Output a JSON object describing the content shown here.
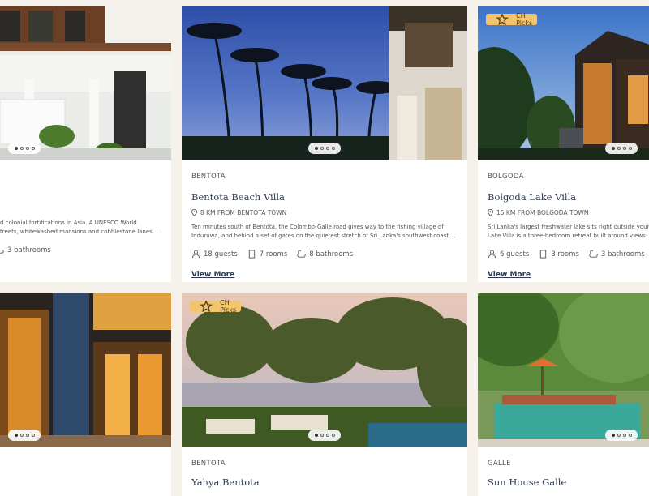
{
  "cards": [
    {
      "region": "",
      "title": "",
      "distance": "",
      "desc_line1": "d colonial fortifications in Asia. A UNESCO World",
      "desc_line2": "treets, whitewashed mansions and cobblestone lanes...",
      "guests": "",
      "rooms": "",
      "bathrooms": "3 bathrooms",
      "view_more": "",
      "badge": ""
    },
    {
      "region": "BENTOTA",
      "title": "Bentota Beach Villa",
      "distance": "8 KM FROM BENTOTA TOWN",
      "desc_line1": "Ten minutes south of Bentota, the Colombo-Galle road gives way to the fishing village of",
      "desc_line2": "Induruwa, and behind a set of gates on the quietest stretch of Sri Lanka's southwest coast,...",
      "guests": "18 guests",
      "rooms": "7 rooms",
      "bathrooms": "8 bathrooms",
      "view_more": "View More",
      "badge": ""
    },
    {
      "region": "BOLGODA",
      "title": "Bolgoda Lake Villa",
      "distance": "15 KM FROM BOLGODA TOWN",
      "desc_line1": "Sri Lanka's largest freshwater lake sits right outside your d",
      "desc_line2": "Lake Villa is a three-bedroom retreat built around views: f",
      "guests": "6 guests",
      "rooms": "3 rooms",
      "bathrooms": "3 bathrooms",
      "view_more": "View More",
      "badge": "CH Picks"
    },
    {
      "region": "",
      "title": "",
      "badge": ""
    },
    {
      "region": "BENTOTA",
      "title": "Yahya Bentota",
      "badge": "CH Picks"
    },
    {
      "region": "GALLE",
      "title": "Sun House Galle",
      "badge": ""
    }
  ],
  "colors": {
    "background": "#f6f1ea",
    "title": "#2f3b55",
    "badge": "#f3c56b"
  }
}
